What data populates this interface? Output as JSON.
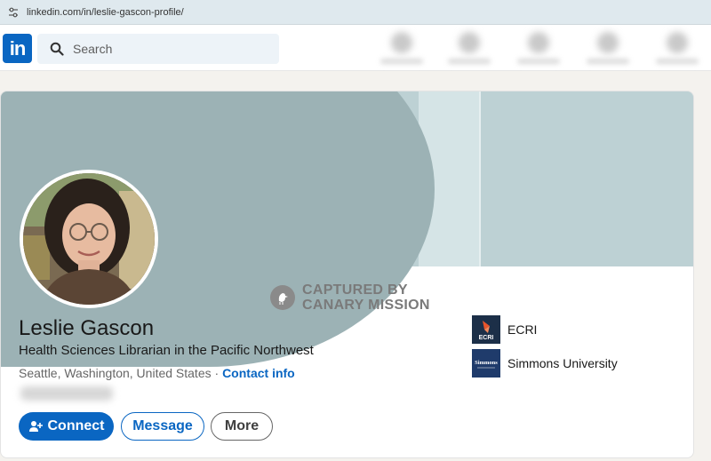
{
  "browser": {
    "url": "linkedin.com/in/leslie-gascon-profile/"
  },
  "nav": {
    "logo_text": "in",
    "search_placeholder": "Search"
  },
  "watermark": {
    "line1": "CAPTURED BY",
    "line2": "CANARY MISSION"
  },
  "profile": {
    "name": "Leslie Gascon",
    "headline": "Health Sciences Librarian in the Pacific Northwest",
    "location": "Seattle, Washington, United States",
    "separator": " · ",
    "contact_label": "Contact info"
  },
  "actions": {
    "connect": "Connect",
    "message": "Message",
    "more": "More"
  },
  "organizations": [
    {
      "name": "ECRI",
      "logo_text": "ECRI"
    },
    {
      "name": "Simmons University",
      "logo_text": "Simmons"
    }
  ],
  "colors": {
    "brand": "#0a66c2",
    "banner_dark": "#9cb2b5",
    "banner_light": "#bdd1d4"
  }
}
